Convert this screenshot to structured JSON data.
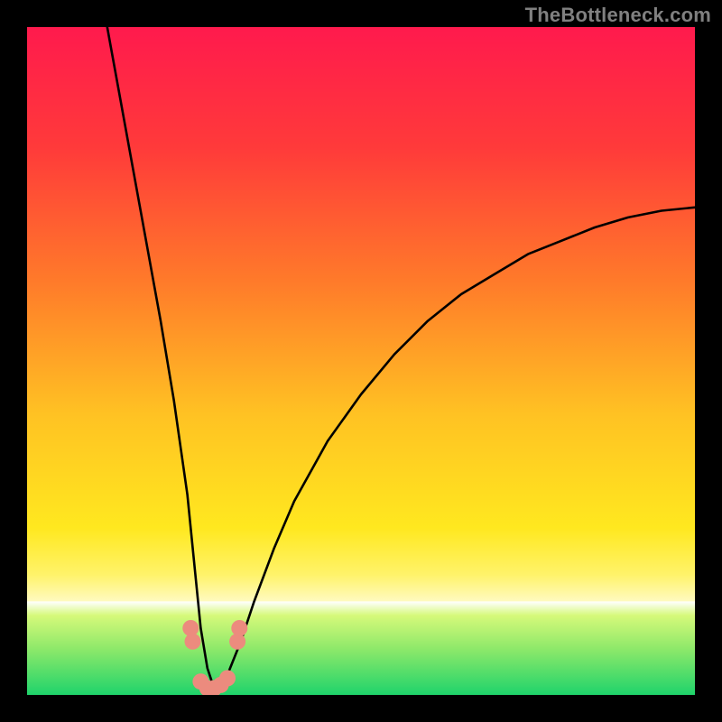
{
  "attribution": "TheBottleneck.com",
  "colors": {
    "black": "#000000",
    "gray_text": "#808080",
    "gradient_stops": [
      {
        "offset": "0%",
        "color": "#ff1a4d"
      },
      {
        "offset": "18%",
        "color": "#ff3a3a"
      },
      {
        "offset": "38%",
        "color": "#ff7a2a"
      },
      {
        "offset": "58%",
        "color": "#ffc223"
      },
      {
        "offset": "75%",
        "color": "#ffe81f"
      },
      {
        "offset": "82%",
        "color": "#fff36a"
      },
      {
        "offset": "86%",
        "color": "#fffac0"
      }
    ],
    "green_top": "#d6f97a",
    "green_mid": "#8fe96a",
    "green_bot": "#1fd36b",
    "marker": "#ec8b7e",
    "curve": "#000000"
  },
  "chart_data": {
    "type": "line",
    "title": "",
    "xlabel": "",
    "ylabel": "",
    "xlim": [
      0,
      100
    ],
    "ylim": [
      0,
      100
    ],
    "series": [
      {
        "name": "bottleneck-curve",
        "x": [
          12,
          14,
          16,
          18,
          20,
          22,
          24,
          25,
          26,
          27,
          28,
          29,
          30,
          32,
          34,
          37,
          40,
          45,
          50,
          55,
          60,
          65,
          70,
          75,
          80,
          85,
          90,
          95,
          100
        ],
        "y": [
          100,
          89,
          78,
          67,
          56,
          44,
          30,
          20,
          10,
          4,
          1,
          1,
          3,
          8,
          14,
          22,
          29,
          38,
          45,
          51,
          56,
          60,
          63,
          66,
          68,
          70,
          71.5,
          72.5,
          73
        ]
      }
    ],
    "markers": {
      "name": "highlight-dots",
      "points": [
        {
          "x": 24.5,
          "y": 10
        },
        {
          "x": 24.8,
          "y": 8
        },
        {
          "x": 26.0,
          "y": 2
        },
        {
          "x": 27.0,
          "y": 1
        },
        {
          "x": 28.0,
          "y": 1
        },
        {
          "x": 29.0,
          "y": 1.5
        },
        {
          "x": 30.0,
          "y": 2.5
        },
        {
          "x": 31.5,
          "y": 8
        },
        {
          "x": 31.8,
          "y": 10
        }
      ],
      "radius": 9
    },
    "green_band": {
      "y_start": 86,
      "y_end": 100
    }
  }
}
